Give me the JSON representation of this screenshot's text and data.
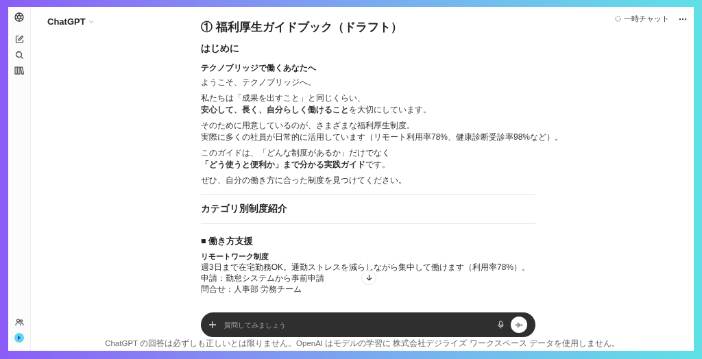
{
  "header": {
    "model": "ChatGPT",
    "temp_chat": "一時チャット"
  },
  "document": [
    {
      "kind": "title",
      "text": "① 福利厚生ガイドブック（ドラフト）"
    },
    {
      "kind": "heading",
      "text": "はじめに"
    },
    {
      "kind": "subheading",
      "text": "テクノブリッジで働くあなたへ"
    },
    {
      "kind": "paragraph",
      "lines": [
        "ようこそ、テクノブリッジへ。"
      ]
    },
    {
      "kind": "paragraph",
      "lines": [
        "私たちは「成果を出すこと」と同じくらい、",
        "**安心して、長く、自分らしく働けること**を大切にしています。"
      ]
    },
    {
      "kind": "paragraph",
      "lines": [
        "そのために用意しているのが、さまざまな福利厚生制度。",
        "実際に多くの社員が日常的に活用しています（リモート利用率78%、健康診断受診率98%など）。"
      ]
    },
    {
      "kind": "paragraph",
      "lines": [
        "このガイドは、「どんな制度があるか」だけでなく",
        "**「どう使うと便利か」まで分かる実践ガイド**です。"
      ]
    },
    {
      "kind": "paragraph",
      "lines": [
        "ぜひ、自分の働き方に合った制度を見つけてください。"
      ]
    },
    {
      "kind": "divider"
    },
    {
      "kind": "heading",
      "text": "カテゴリ別制度紹介"
    },
    {
      "kind": "divider"
    },
    {
      "kind": "section",
      "text": "■ 働き方支援"
    },
    {
      "kind": "item",
      "title": "リモートワーク制度",
      "lines": [
        "週3日まで在宅勤務OK。通勤ストレスを減らしながら集中して働けます（利用率78%）。",
        "申請：勤怠システムから事前申請",
        "問合せ：人事部 労務チーム"
      ]
    }
  ],
  "composer": {
    "placeholder": "質問してみましょう"
  },
  "footer": "ChatGPT の回答は必ずしも正しいとは限りません。OpenAI はモデルの学習に 株式会社デジライズ ワークスペース データを使用しません。"
}
